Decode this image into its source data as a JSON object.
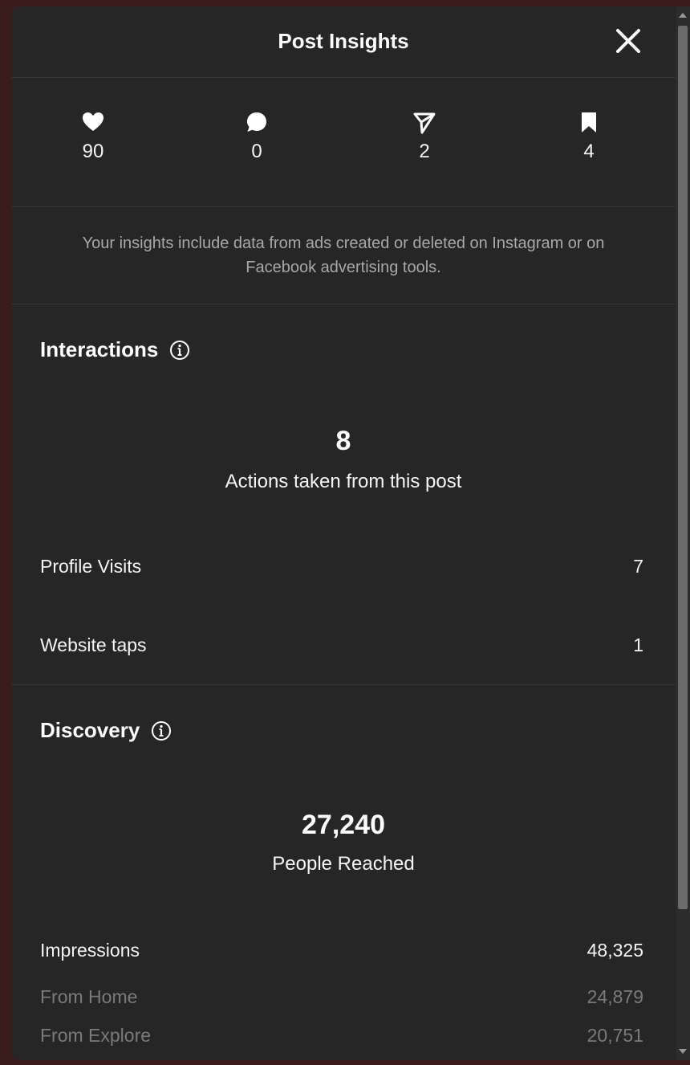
{
  "header": {
    "title": "Post Insights"
  },
  "stats": {
    "likes": "90",
    "comments": "0",
    "shares": "2",
    "saves": "4"
  },
  "notice": {
    "text": "Your insights include data from ads created or deleted on Instagram or on Facebook advertising tools."
  },
  "interactions": {
    "title": "Interactions",
    "total": "8",
    "caption": "Actions taken from this post",
    "rows": [
      {
        "label": "Profile Visits",
        "value": "7"
      },
      {
        "label": "Website taps",
        "value": "1"
      }
    ]
  },
  "discovery": {
    "title": "Discovery",
    "total": "27,240",
    "caption": "People Reached",
    "impressions": {
      "label": "Impressions",
      "value": "48,325"
    },
    "sources": [
      {
        "label": "From Home",
        "value": "24,879"
      },
      {
        "label": "From Explore",
        "value": "20,751"
      }
    ]
  },
  "icons": {
    "likes": "heart-icon",
    "comments": "comment-icon",
    "shares": "share-icon",
    "saves": "bookmark-icon",
    "close": "close-icon",
    "info": "info-icon"
  },
  "colors": {
    "background": "#262626",
    "text": "#f5f5f5",
    "muted": "#a8a8a8",
    "divider": "#363636"
  }
}
